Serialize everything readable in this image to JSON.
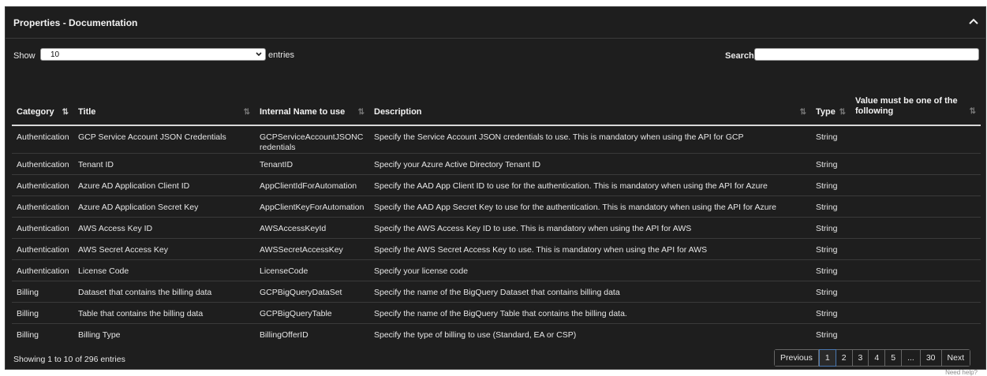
{
  "panel": {
    "title": "Properties - Documentation"
  },
  "controls": {
    "show_label": "Show",
    "length_value": "10",
    "entries_label": "entries",
    "search_label": "Search:",
    "search_value": ""
  },
  "table": {
    "headers": {
      "category": "Category",
      "title": "Title",
      "internal_name": "Internal Name to use",
      "description": "Description",
      "type": "Type",
      "value_one_of": "Value must be one of the following"
    },
    "rows": [
      {
        "category": "Authentication",
        "title": "GCP Service Account JSON Credentials",
        "internal_name": "GCPServiceAccountJSONCredentials",
        "description": "Specify the Service Account JSON credentials to use. This is mandatory when using the API for GCP",
        "type": "String",
        "value": ""
      },
      {
        "category": "Authentication",
        "title": "Tenant ID",
        "internal_name": "TenantID",
        "description": "Specify your Azure Active Directory Tenant ID",
        "type": "String",
        "value": ""
      },
      {
        "category": "Authentication",
        "title": "Azure AD Application Client ID",
        "internal_name": "AppClientIdForAutomation",
        "description": "Specify the AAD App Client ID to use for the authentication. This is mandatory when using the API for Azure",
        "type": "String",
        "value": ""
      },
      {
        "category": "Authentication",
        "title": "Azure AD Application Secret Key",
        "internal_name": "AppClientKeyForAutomation",
        "description": "Specify the AAD App Secret Key to use for the authentication. This is mandatory when using the API for Azure",
        "type": "String",
        "value": ""
      },
      {
        "category": "Authentication",
        "title": "AWS Access Key ID",
        "internal_name": "AWSAccessKeyId",
        "description": "Specify the AWS Access Key ID to use. This is mandatory when using the API for AWS",
        "type": "String",
        "value": ""
      },
      {
        "category": "Authentication",
        "title": "AWS Secret Access Key",
        "internal_name": "AWSSecretAccessKey",
        "description": "Specify the AWS Secret Access Key to use. This is mandatory when using the API for AWS",
        "type": "String",
        "value": ""
      },
      {
        "category": "Authentication",
        "title": "License Code",
        "internal_name": "LicenseCode",
        "description": "Specify your license code",
        "type": "String",
        "value": ""
      },
      {
        "category": "Billing",
        "title": "Dataset that contains the billing data",
        "internal_name": "GCPBigQueryDataSet",
        "description": "Specify the name of the BigQuery Dataset that contains billing data",
        "type": "String",
        "value": ""
      },
      {
        "category": "Billing",
        "title": "Table that contains the billing data",
        "internal_name": "GCPBigQueryTable",
        "description": "Specify the name of the BigQuery Table that contains the billing data.",
        "type": "String",
        "value": ""
      },
      {
        "category": "Billing",
        "title": "Billing Type",
        "internal_name": "BillingOfferID",
        "description": "Specify the type of billing to use (Standard, EA or CSP)",
        "type": "String",
        "value": ""
      }
    ]
  },
  "footer": {
    "info": "Showing 1 to 10 of 296 entries",
    "pagination": {
      "previous": "Previous",
      "pages": [
        "1",
        "2",
        "3",
        "4",
        "5",
        "...",
        "30"
      ],
      "next": "Next",
      "current": "1"
    },
    "help": "Need help?"
  }
}
